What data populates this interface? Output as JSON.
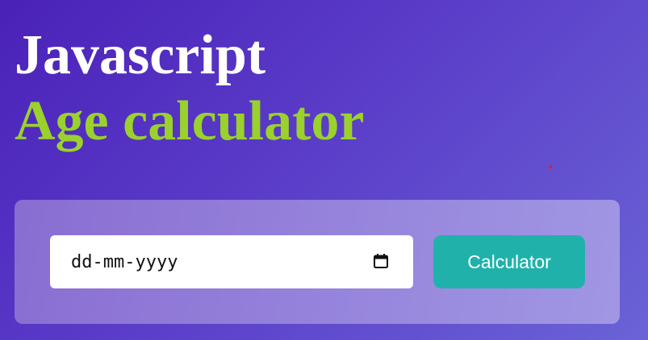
{
  "heading": {
    "line1": "Javascript",
    "line2": "Age calculator"
  },
  "form": {
    "date_placeholder": "dd-mm-yyyy",
    "calculate_label": "Calculator",
    "calendar_icon": "calendar-icon"
  },
  "colors": {
    "background_start": "#4a21b8",
    "background_end": "#6a63d6",
    "title_primary": "#ffffff",
    "title_accent": "#9ad12c",
    "button": "#20b2aa",
    "input_bg": "#ffffff"
  }
}
